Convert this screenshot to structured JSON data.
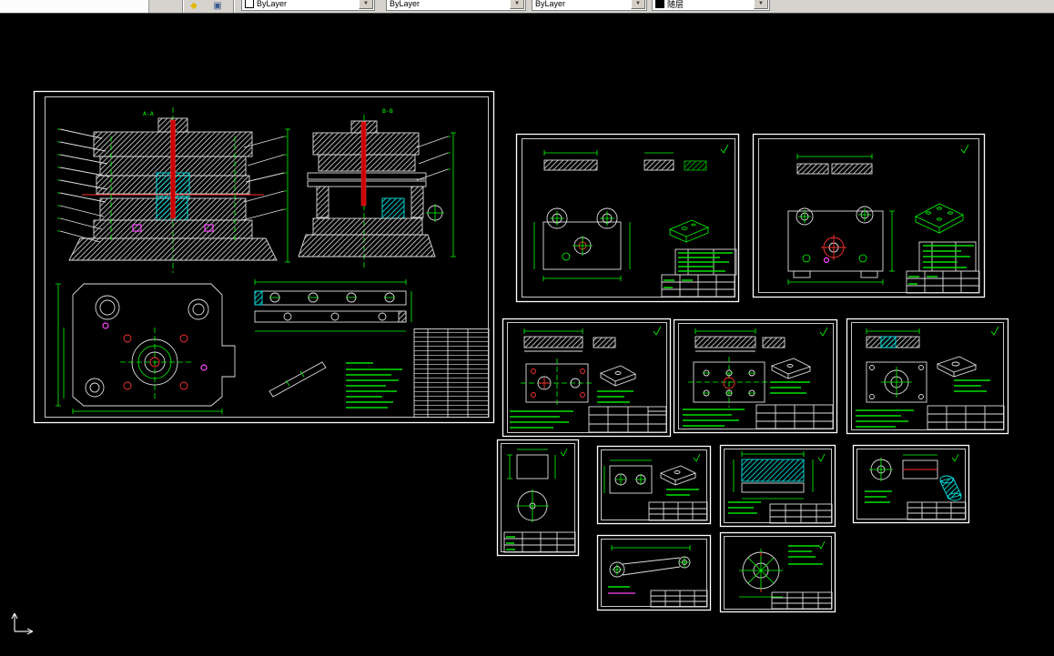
{
  "toolbar": {
    "controls": [
      {
        "name": "color-control",
        "value": "ByLayer",
        "swatch": "#ffffff"
      },
      {
        "name": "linetype-control",
        "value": "ByLayer"
      },
      {
        "name": "lineweight-control",
        "value": "ByLayer"
      },
      {
        "name": "plotstyle-control",
        "value": "随层",
        "swatch": "#000000"
      }
    ],
    "dropdown_glyph": "▼",
    "icon1": "◆",
    "icon2": "▣"
  },
  "canvas": {
    "background": "#000000",
    "view_labels": {
      "section_a": "A-A",
      "section_b": "B-B"
    },
    "sheet_count": 12,
    "sheets": [
      {
        "id": "sheet-assembly"
      },
      {
        "id": "sheet-part-01"
      },
      {
        "id": "sheet-part-02"
      },
      {
        "id": "sheet-part-03"
      },
      {
        "id": "sheet-part-04"
      },
      {
        "id": "sheet-part-05"
      },
      {
        "id": "sheet-part-06"
      },
      {
        "id": "sheet-part-07"
      },
      {
        "id": "sheet-part-08"
      },
      {
        "id": "sheet-part-09"
      },
      {
        "id": "sheet-part-10"
      },
      {
        "id": "sheet-part-11"
      }
    ]
  },
  "palette": {
    "green": "#00ff00",
    "white": "#ffffff",
    "red": "#ff3232",
    "cyan": "#00e6e6",
    "magenta": "#ff46ff",
    "toolbar_bg": "#d6d3ce"
  }
}
